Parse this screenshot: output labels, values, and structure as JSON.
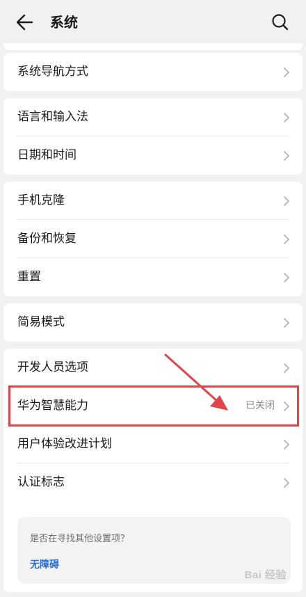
{
  "header": {
    "title": "系统"
  },
  "groups": [
    {
      "items": [
        {
          "label": "系统导航方式",
          "value": ""
        }
      ]
    },
    {
      "items": [
        {
          "label": "语言和输入法",
          "value": ""
        },
        {
          "label": "日期和时间",
          "value": ""
        }
      ]
    },
    {
      "items": [
        {
          "label": "手机克隆",
          "value": ""
        },
        {
          "label": "备份和恢复",
          "value": ""
        },
        {
          "label": "重置",
          "value": ""
        }
      ]
    },
    {
      "items": [
        {
          "label": "简易模式",
          "value": ""
        }
      ]
    },
    {
      "items": [
        {
          "label": "开发人员选项",
          "value": ""
        },
        {
          "label": "华为智慧能力",
          "value": "已关闭"
        },
        {
          "label": "用户体验改进计划",
          "value": ""
        },
        {
          "label": "认证标志",
          "value": ""
        }
      ]
    }
  ],
  "suggestion": {
    "question": "是否在寻找其他设置项？",
    "link": "无障碍"
  },
  "annotation": {
    "color": "#e0454b"
  },
  "watermark": {
    "text": "Bai 经验"
  }
}
